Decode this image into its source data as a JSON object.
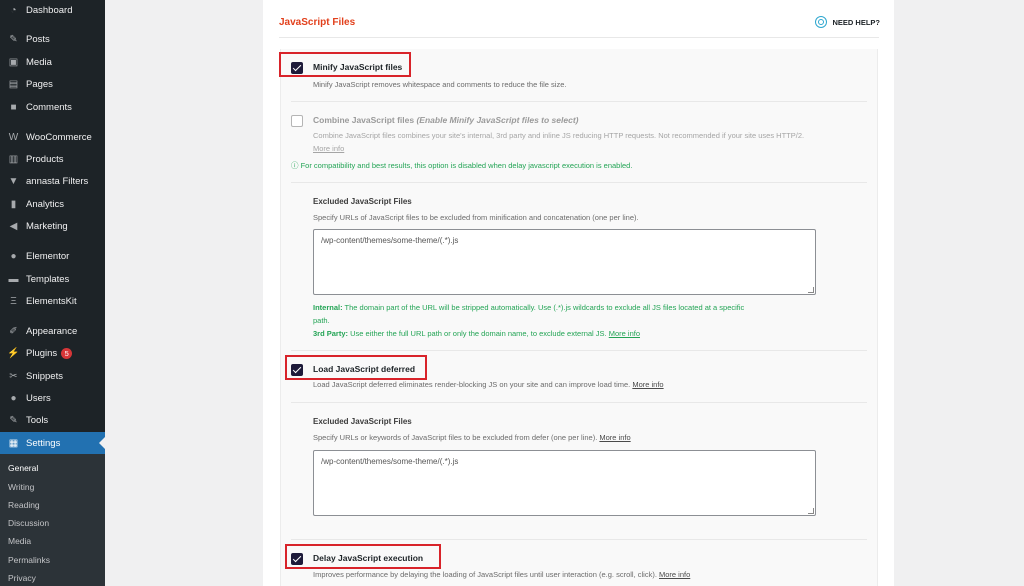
{
  "sidebar": {
    "items": [
      {
        "label": "Dashboard",
        "icon": "dashboard-icon",
        "glyph": "◔"
      },
      {
        "label": "Posts",
        "icon": "pin-icon",
        "glyph": "✎"
      },
      {
        "label": "Media",
        "icon": "media-icon",
        "glyph": "▣"
      },
      {
        "label": "Pages",
        "icon": "pages-icon",
        "glyph": "▤"
      },
      {
        "label": "Comments",
        "icon": "comments-icon",
        "glyph": "■"
      },
      {
        "label": "WooCommerce",
        "icon": "woo-icon",
        "glyph": "W"
      },
      {
        "label": "Products",
        "icon": "products-icon",
        "glyph": "▥"
      },
      {
        "label": "annasta Filters",
        "icon": "filter-icon",
        "glyph": "▼"
      },
      {
        "label": "Analytics",
        "icon": "analytics-icon",
        "glyph": "▮"
      },
      {
        "label": "Marketing",
        "icon": "megaphone-icon",
        "glyph": "◀"
      },
      {
        "label": "Elementor",
        "icon": "elementor-icon",
        "glyph": "●"
      },
      {
        "label": "Templates",
        "icon": "folder-icon",
        "glyph": "▬"
      },
      {
        "label": "ElementsKit",
        "icon": "elementskit-icon",
        "glyph": "Ξ"
      },
      {
        "label": "Appearance",
        "icon": "brush-icon",
        "glyph": "✐"
      },
      {
        "label": "Plugins",
        "icon": "plugin-icon",
        "glyph": "⚡",
        "badge": "5"
      },
      {
        "label": "Snippets",
        "icon": "snippets-icon",
        "glyph": "✂"
      },
      {
        "label": "Users",
        "icon": "users-icon",
        "glyph": "●"
      },
      {
        "label": "Tools",
        "icon": "wrench-icon",
        "glyph": "✎"
      },
      {
        "label": "Settings",
        "icon": "settings-icon",
        "glyph": "▦",
        "active": true
      }
    ],
    "submenu": [
      "General",
      "Writing",
      "Reading",
      "Discussion",
      "Media",
      "Permalinks",
      "Privacy"
    ]
  },
  "panel": {
    "title": "JavaScript Files",
    "help_label": "NEED HELP?",
    "minify": {
      "label": "Minify JavaScript files",
      "checked": true,
      "desc": "Minify JavaScript removes whitespace and comments to reduce the file size."
    },
    "combine": {
      "label": "Combine JavaScript files",
      "label_suffix": "(Enable Minify JavaScript files to select)",
      "checked": false,
      "desc": "Combine JavaScript files combines your site's internal, 3rd party and inline JS reducing HTTP requests. Not recommended if your site uses HTTP/2.",
      "more_info": "More info",
      "notice": "For compatibility and best results, this option is disabled when delay javascript execution is enabled."
    },
    "excluded_minify": {
      "heading": "Excluded JavaScript Files",
      "desc": "Specify URLs of JavaScript files to be excluded from minification and concatenation (one per line).",
      "value": "/wp-content/themes/some-theme/(.*).js",
      "internal_label": "Internal:",
      "internal_text": "The domain part of the URL will be stripped automatically. Use (.*).js wildcards to exclude all JS files located at a specific",
      "internal_text_2": "path.",
      "thirdparty_label": "3rd Party:",
      "thirdparty_text": "Use either the full URL path or only the domain name, to exclude external JS.",
      "more_info": "More info"
    },
    "defer": {
      "label": "Load JavaScript deferred",
      "checked": true,
      "desc": "Load JavaScript deferred eliminates render-blocking JS on your site and can improve load time.",
      "more_info": "More info"
    },
    "excluded_defer": {
      "heading": "Excluded JavaScript Files",
      "desc": "Specify URLs or keywords of JavaScript files to be excluded from defer (one per line).",
      "more_info": "More info",
      "value": "/wp-content/themes/some-theme/(.*).js"
    },
    "delay": {
      "label": "Delay JavaScript execution",
      "checked": true,
      "desc": "Improves performance by delaying the loading of JavaScript files until user interaction (e.g. scroll, click).",
      "more_info": "More info"
    }
  }
}
